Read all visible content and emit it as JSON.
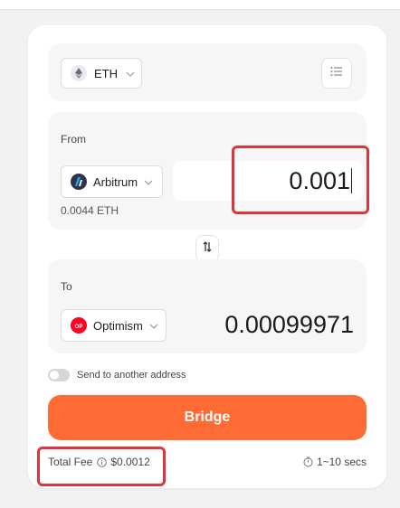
{
  "token": {
    "symbol": "ETH"
  },
  "from": {
    "label": "From",
    "chain": "Arbitrum",
    "balance": "0.0044 ETH",
    "amount": "0.001"
  },
  "to": {
    "label": "To",
    "chain": "Optimism",
    "amount": "0.00099971"
  },
  "send_toggle": {
    "label": "Send to another address"
  },
  "bridge_button": {
    "label": "Bridge"
  },
  "fee": {
    "label": "Total Fee",
    "value": "$0.0012"
  },
  "time": {
    "label": "1~10 secs"
  },
  "colors": {
    "accent": "#ff6b35",
    "highlight": "#d9363e"
  },
  "icons": [
    "eth-icon",
    "chevron-down-icon",
    "list-icon",
    "arbitrum-icon",
    "swap-icon",
    "optimism-icon",
    "info-icon",
    "timer-icon"
  ]
}
